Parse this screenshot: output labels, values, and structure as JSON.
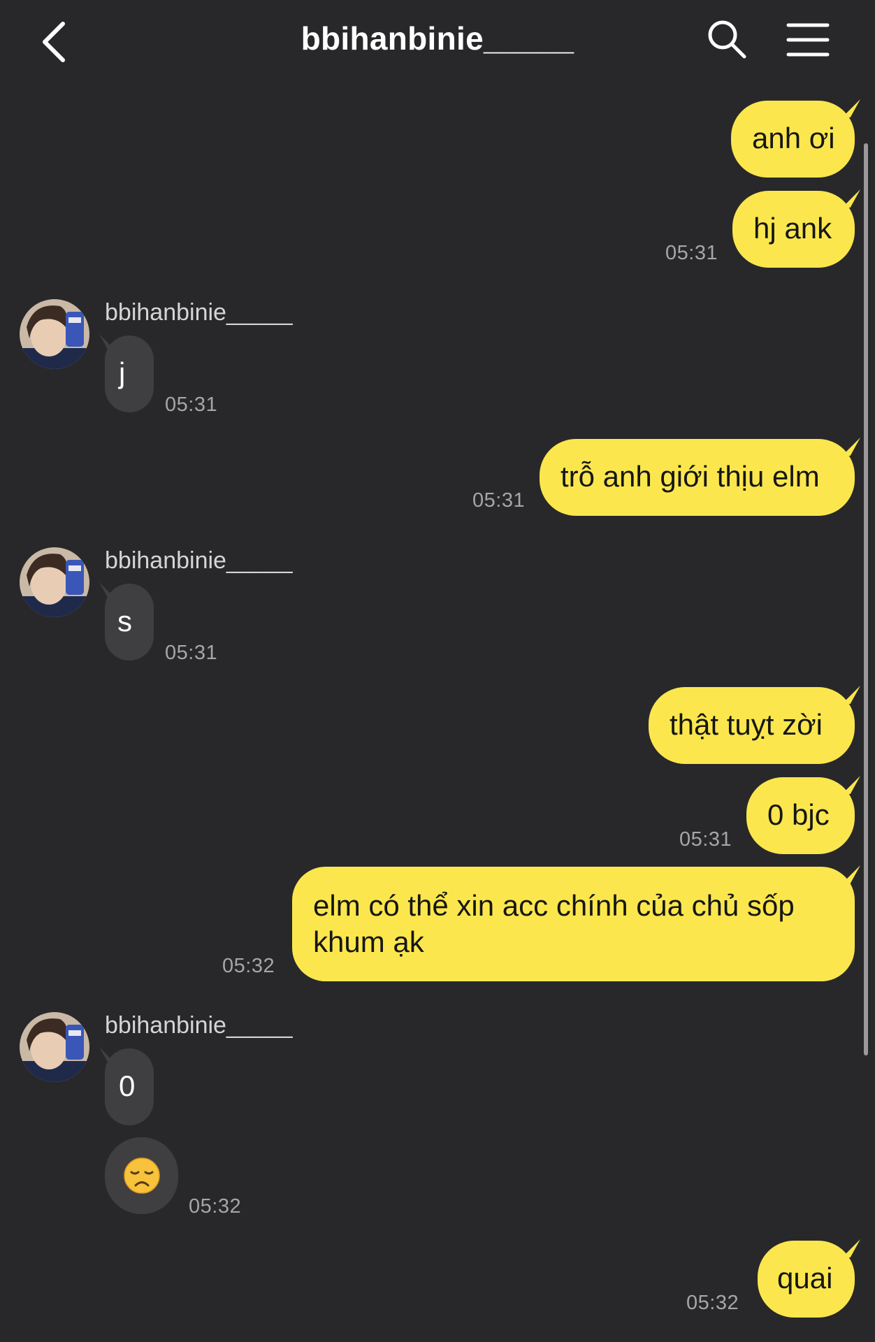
{
  "header": {
    "title": "bbihanbinie_____"
  },
  "sender_name": "bbihanbinie_____",
  "messages": [
    {
      "text": "anh ơi"
    },
    {
      "text": "hj ank",
      "time": "05:31"
    },
    {
      "text": "j",
      "time": "05:31"
    },
    {
      "text": "trỗ anh giới thịu elm",
      "time": "05:31"
    },
    {
      "text": "s",
      "time": "05:31"
    },
    {
      "text": "thật tuỵt zời"
    },
    {
      "text": "0 bjc",
      "time": "05:31"
    },
    {
      "line1": "elm có thể xin acc chính của chủ sốp",
      "line2": "khum ạk",
      "time": "05:32"
    },
    {
      "text": "0"
    },
    {
      "emoji": "disappointed-face",
      "time": "05:32"
    },
    {
      "text": "quai",
      "time": "05:32"
    }
  ],
  "colors": {
    "background": "#28282a",
    "my_bubble": "#fbe74d",
    "their_bubble": "#3f3f42"
  }
}
